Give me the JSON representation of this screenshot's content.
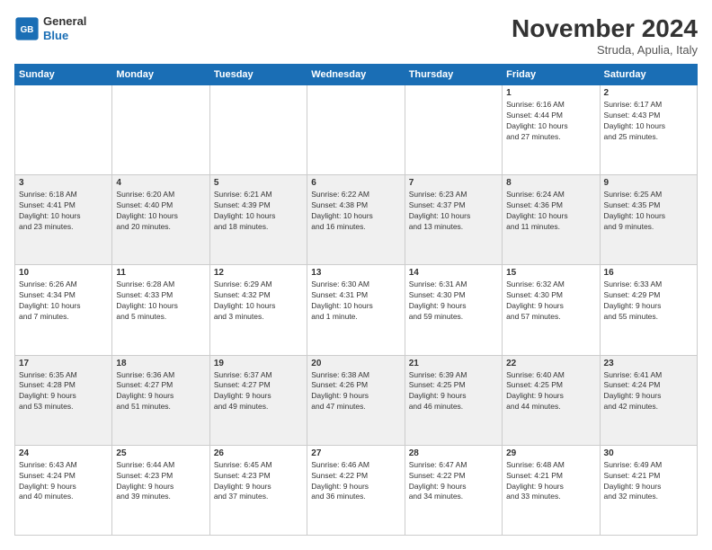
{
  "logo": {
    "general": "General",
    "blue": "Blue"
  },
  "header": {
    "month": "November 2024",
    "location": "Struda, Apulia, Italy"
  },
  "days_of_week": [
    "Sunday",
    "Monday",
    "Tuesday",
    "Wednesday",
    "Thursday",
    "Friday",
    "Saturday"
  ],
  "weeks": [
    [
      {
        "day": "",
        "info": ""
      },
      {
        "day": "",
        "info": ""
      },
      {
        "day": "",
        "info": ""
      },
      {
        "day": "",
        "info": ""
      },
      {
        "day": "",
        "info": ""
      },
      {
        "day": "1",
        "info": "Sunrise: 6:16 AM\nSunset: 4:44 PM\nDaylight: 10 hours\nand 27 minutes."
      },
      {
        "day": "2",
        "info": "Sunrise: 6:17 AM\nSunset: 4:43 PM\nDaylight: 10 hours\nand 25 minutes."
      }
    ],
    [
      {
        "day": "3",
        "info": "Sunrise: 6:18 AM\nSunset: 4:41 PM\nDaylight: 10 hours\nand 23 minutes."
      },
      {
        "day": "4",
        "info": "Sunrise: 6:20 AM\nSunset: 4:40 PM\nDaylight: 10 hours\nand 20 minutes."
      },
      {
        "day": "5",
        "info": "Sunrise: 6:21 AM\nSunset: 4:39 PM\nDaylight: 10 hours\nand 18 minutes."
      },
      {
        "day": "6",
        "info": "Sunrise: 6:22 AM\nSunset: 4:38 PM\nDaylight: 10 hours\nand 16 minutes."
      },
      {
        "day": "7",
        "info": "Sunrise: 6:23 AM\nSunset: 4:37 PM\nDaylight: 10 hours\nand 13 minutes."
      },
      {
        "day": "8",
        "info": "Sunrise: 6:24 AM\nSunset: 4:36 PM\nDaylight: 10 hours\nand 11 minutes."
      },
      {
        "day": "9",
        "info": "Sunrise: 6:25 AM\nSunset: 4:35 PM\nDaylight: 10 hours\nand 9 minutes."
      }
    ],
    [
      {
        "day": "10",
        "info": "Sunrise: 6:26 AM\nSunset: 4:34 PM\nDaylight: 10 hours\nand 7 minutes."
      },
      {
        "day": "11",
        "info": "Sunrise: 6:28 AM\nSunset: 4:33 PM\nDaylight: 10 hours\nand 5 minutes."
      },
      {
        "day": "12",
        "info": "Sunrise: 6:29 AM\nSunset: 4:32 PM\nDaylight: 10 hours\nand 3 minutes."
      },
      {
        "day": "13",
        "info": "Sunrise: 6:30 AM\nSunset: 4:31 PM\nDaylight: 10 hours\nand 1 minute."
      },
      {
        "day": "14",
        "info": "Sunrise: 6:31 AM\nSunset: 4:30 PM\nDaylight: 9 hours\nand 59 minutes."
      },
      {
        "day": "15",
        "info": "Sunrise: 6:32 AM\nSunset: 4:30 PM\nDaylight: 9 hours\nand 57 minutes."
      },
      {
        "day": "16",
        "info": "Sunrise: 6:33 AM\nSunset: 4:29 PM\nDaylight: 9 hours\nand 55 minutes."
      }
    ],
    [
      {
        "day": "17",
        "info": "Sunrise: 6:35 AM\nSunset: 4:28 PM\nDaylight: 9 hours\nand 53 minutes."
      },
      {
        "day": "18",
        "info": "Sunrise: 6:36 AM\nSunset: 4:27 PM\nDaylight: 9 hours\nand 51 minutes."
      },
      {
        "day": "19",
        "info": "Sunrise: 6:37 AM\nSunset: 4:27 PM\nDaylight: 9 hours\nand 49 minutes."
      },
      {
        "day": "20",
        "info": "Sunrise: 6:38 AM\nSunset: 4:26 PM\nDaylight: 9 hours\nand 47 minutes."
      },
      {
        "day": "21",
        "info": "Sunrise: 6:39 AM\nSunset: 4:25 PM\nDaylight: 9 hours\nand 46 minutes."
      },
      {
        "day": "22",
        "info": "Sunrise: 6:40 AM\nSunset: 4:25 PM\nDaylight: 9 hours\nand 44 minutes."
      },
      {
        "day": "23",
        "info": "Sunrise: 6:41 AM\nSunset: 4:24 PM\nDaylight: 9 hours\nand 42 minutes."
      }
    ],
    [
      {
        "day": "24",
        "info": "Sunrise: 6:43 AM\nSunset: 4:24 PM\nDaylight: 9 hours\nand 40 minutes."
      },
      {
        "day": "25",
        "info": "Sunrise: 6:44 AM\nSunset: 4:23 PM\nDaylight: 9 hours\nand 39 minutes."
      },
      {
        "day": "26",
        "info": "Sunrise: 6:45 AM\nSunset: 4:23 PM\nDaylight: 9 hours\nand 37 minutes."
      },
      {
        "day": "27",
        "info": "Sunrise: 6:46 AM\nSunset: 4:22 PM\nDaylight: 9 hours\nand 36 minutes."
      },
      {
        "day": "28",
        "info": "Sunrise: 6:47 AM\nSunset: 4:22 PM\nDaylight: 9 hours\nand 34 minutes."
      },
      {
        "day": "29",
        "info": "Sunrise: 6:48 AM\nSunset: 4:21 PM\nDaylight: 9 hours\nand 33 minutes."
      },
      {
        "day": "30",
        "info": "Sunrise: 6:49 AM\nSunset: 4:21 PM\nDaylight: 9 hours\nand 32 minutes."
      }
    ]
  ]
}
